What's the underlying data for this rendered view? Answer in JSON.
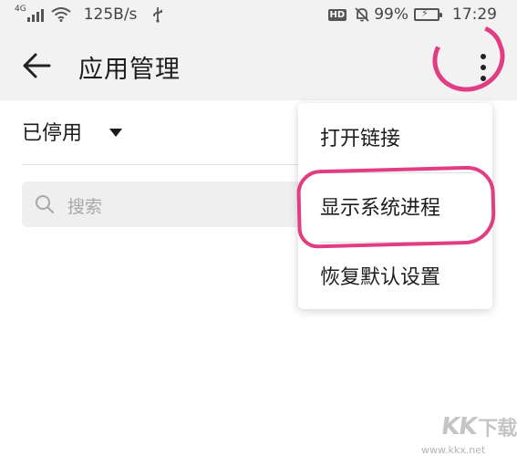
{
  "status_bar": {
    "network_type": "4G",
    "speed": "125B/s",
    "battery_percent": "99%",
    "time": "17:29",
    "hd_badge": "HD",
    "icons": [
      "signal-icon",
      "wifi-icon",
      "usb-icon",
      "hd-icon",
      "mute-bell-icon",
      "battery-icon"
    ]
  },
  "app_bar": {
    "title": "应用管理",
    "back_icon": "arrow-left-icon",
    "more_icon": "more-vertical-icon"
  },
  "filter": {
    "selected": "已停用"
  },
  "search": {
    "placeholder": "搜索"
  },
  "menu": {
    "items": [
      {
        "label": "打开链接"
      },
      {
        "label": "显示系统进程"
      },
      {
        "label": "恢复默认设置"
      }
    ]
  },
  "annotation": {
    "color": "#e03d84"
  },
  "watermark": {
    "logo_text": "KK",
    "logo_cn": "下载",
    "url": "www.kkx.net"
  }
}
